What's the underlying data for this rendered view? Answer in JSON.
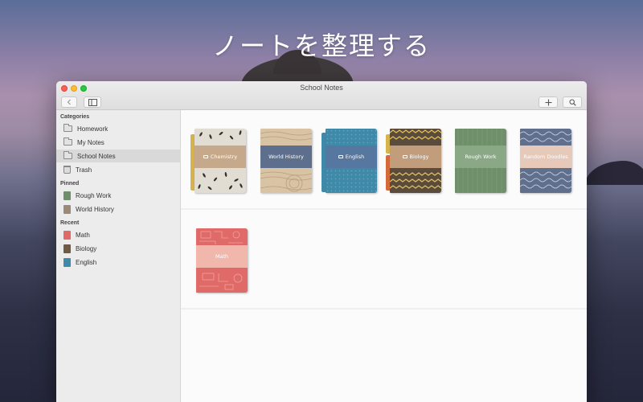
{
  "headline": "ノートを整理する",
  "window": {
    "title": "School Notes"
  },
  "toolbar": {
    "back_icon": "chevron-left-icon",
    "sidebar_icon": "sidebar-toggle-icon",
    "add_icon": "plus-icon",
    "search_icon": "magnifier-icon"
  },
  "sidebar": {
    "categories_header": "Categories",
    "categories": [
      {
        "label": "Homework",
        "icon": "folder-icon"
      },
      {
        "label": "My Notes",
        "icon": "folder-icon"
      },
      {
        "label": "School Notes",
        "icon": "folder-icon",
        "selected": true
      },
      {
        "label": "Trash",
        "icon": "trash-icon"
      }
    ],
    "pinned_header": "Pinned",
    "pinned": [
      {
        "label": "Rough Work",
        "color": "#6f8f6b"
      },
      {
        "label": "World History",
        "color": "#9b8a78"
      }
    ],
    "recent_header": "Recent",
    "recent": [
      {
        "label": "Math",
        "color": "#e06a68"
      },
      {
        "label": "Biology",
        "color": "#6e5a45"
      },
      {
        "label": "English",
        "color": "#3f8aa8"
      }
    ]
  },
  "notebooks": {
    "row1": [
      {
        "label": "Chemistry",
        "folder": true,
        "cover": "#e2ddd2",
        "band": "#c5a98a",
        "tab": "#d7b34c"
      },
      {
        "label": "World History",
        "folder": false,
        "cover": "#d8c4a4",
        "band": "#5d6f8c"
      },
      {
        "label": "English",
        "folder": true,
        "cover": "#3f8aa8",
        "band": "#5677a0",
        "tab": "#3f8aa8"
      },
      {
        "label": "Biology",
        "folder": true,
        "cover": "#5a4b3c",
        "band": "#c29d7c",
        "tab": "#d46a3a"
      },
      {
        "label": "Rough Work",
        "folder": false,
        "cover": "#6f8f6b",
        "band": "#8aa886"
      },
      {
        "label": "Random Doodles",
        "folder": false,
        "cover": "#5f6f8c",
        "band": "#e6c9b8"
      }
    ],
    "row2": [
      {
        "label": "Math",
        "folder": false,
        "cover": "#e06a68",
        "band": "#f1b7ad"
      }
    ]
  }
}
